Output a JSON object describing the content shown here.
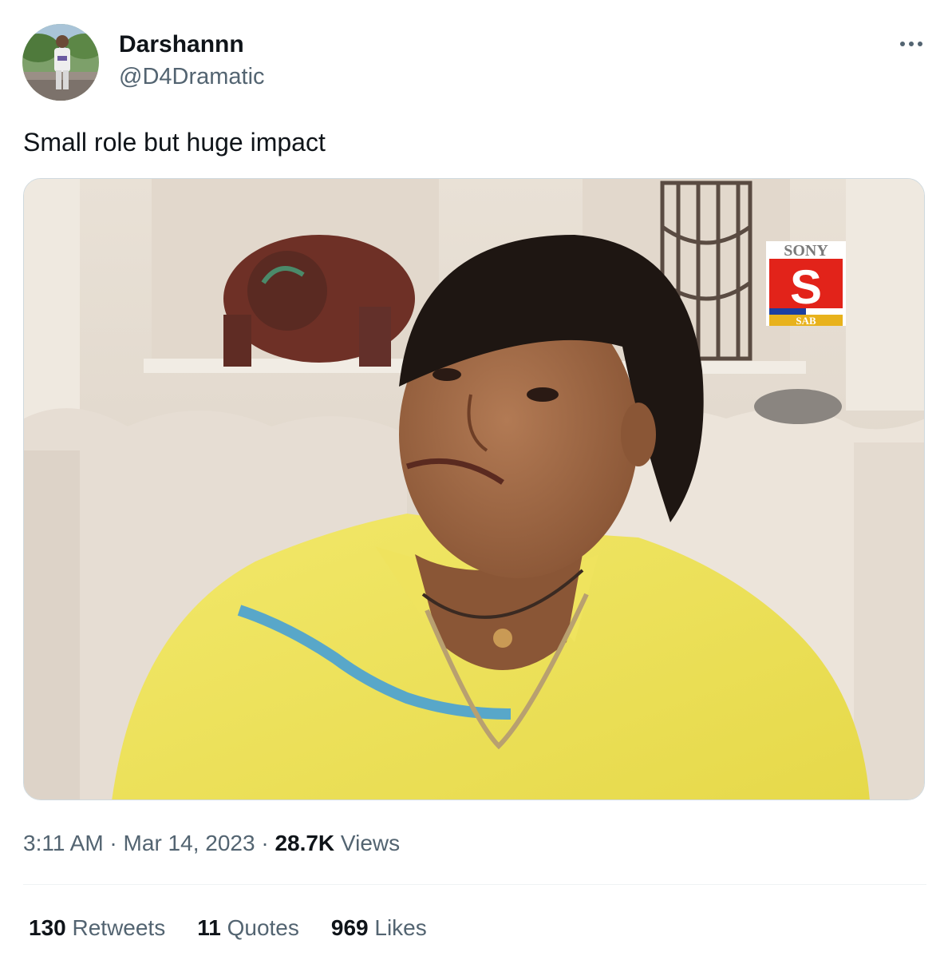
{
  "author": {
    "display_name": "Darshannn",
    "handle": "@D4Dramatic"
  },
  "tweet": {
    "text": "Small role but huge impact"
  },
  "media": {
    "logo_top": "SONY",
    "logo_bottom": "SAB",
    "logo_letter": "S"
  },
  "meta": {
    "time": "3:11 AM",
    "separator": " · ",
    "date": "Mar 14, 2023",
    "views_count": "28.7K",
    "views_label": " Views"
  },
  "stats": {
    "retweets_count": "130",
    "retweets_label": " Retweets",
    "quotes_count": "11",
    "quotes_label": " Quotes",
    "likes_count": "969",
    "likes_label": " Likes"
  },
  "icons": {
    "more": "more-icon"
  },
  "colors": {
    "text_primary": "#0f1419",
    "text_secondary": "#536471",
    "divider": "#eff3f4",
    "media_border": "#cfd9de"
  }
}
